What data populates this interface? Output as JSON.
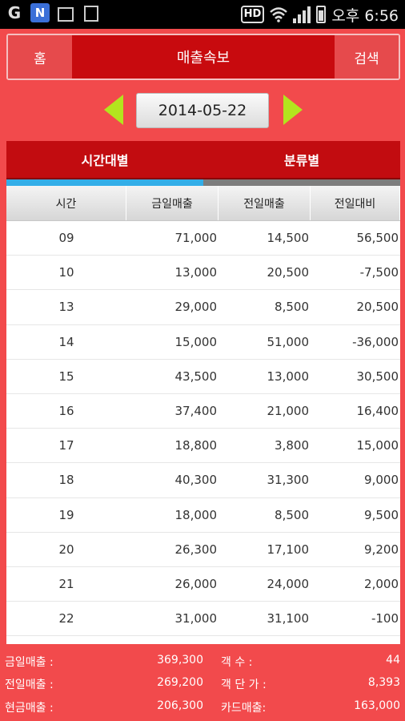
{
  "status_bar": {
    "hd_label": "HD",
    "time": "오후 6:56",
    "icons": [
      "g-icon",
      "n-icon",
      "image-icon",
      "chart-doc-icon",
      "hd-icon",
      "wifi-icon",
      "signal-icon",
      "battery-icon"
    ]
  },
  "header": {
    "home_label": "홈",
    "title": "매출속보",
    "search_label": "검색"
  },
  "date": {
    "value": "2014-05-22"
  },
  "tabs": [
    {
      "label": "시간대별",
      "active": true
    },
    {
      "label": "분류별",
      "active": false
    }
  ],
  "table": {
    "columns": [
      "시간",
      "금일매출",
      "전일매출",
      "전일대비"
    ],
    "rows": [
      [
        "09",
        "71,000",
        "14,500",
        "56,500"
      ],
      [
        "10",
        "13,000",
        "20,500",
        "-7,500"
      ],
      [
        "13",
        "29,000",
        "8,500",
        "20,500"
      ],
      [
        "14",
        "15,000",
        "51,000",
        "-36,000"
      ],
      [
        "15",
        "43,500",
        "13,000",
        "30,500"
      ],
      [
        "16",
        "37,400",
        "21,000",
        "16,400"
      ],
      [
        "17",
        "18,800",
        "3,800",
        "15,000"
      ],
      [
        "18",
        "40,300",
        "31,300",
        "9,000"
      ],
      [
        "19",
        "18,000",
        "8,500",
        "9,500"
      ],
      [
        "20",
        "26,300",
        "17,100",
        "9,200"
      ],
      [
        "21",
        "26,000",
        "24,000",
        "2,000"
      ],
      [
        "22",
        "31,000",
        "31,100",
        "-100"
      ]
    ]
  },
  "summary": [
    {
      "label1": "금일매출 :",
      "value1": "369,300",
      "label2": "객 수 :",
      "value2": "44"
    },
    {
      "label1": "전일매출 :",
      "value1": "269,200",
      "label2": "객 단 가 :",
      "value2": "8,393"
    },
    {
      "label1": "현금매출 :",
      "value1": "206,300",
      "label2": "카드매출:",
      "value2": "163,000"
    }
  ],
  "colors": {
    "background": "#f24a4c",
    "header_bar": "#c80a0e",
    "arrow": "#b3e41e",
    "tab_active_indicator": "#33aee8"
  }
}
